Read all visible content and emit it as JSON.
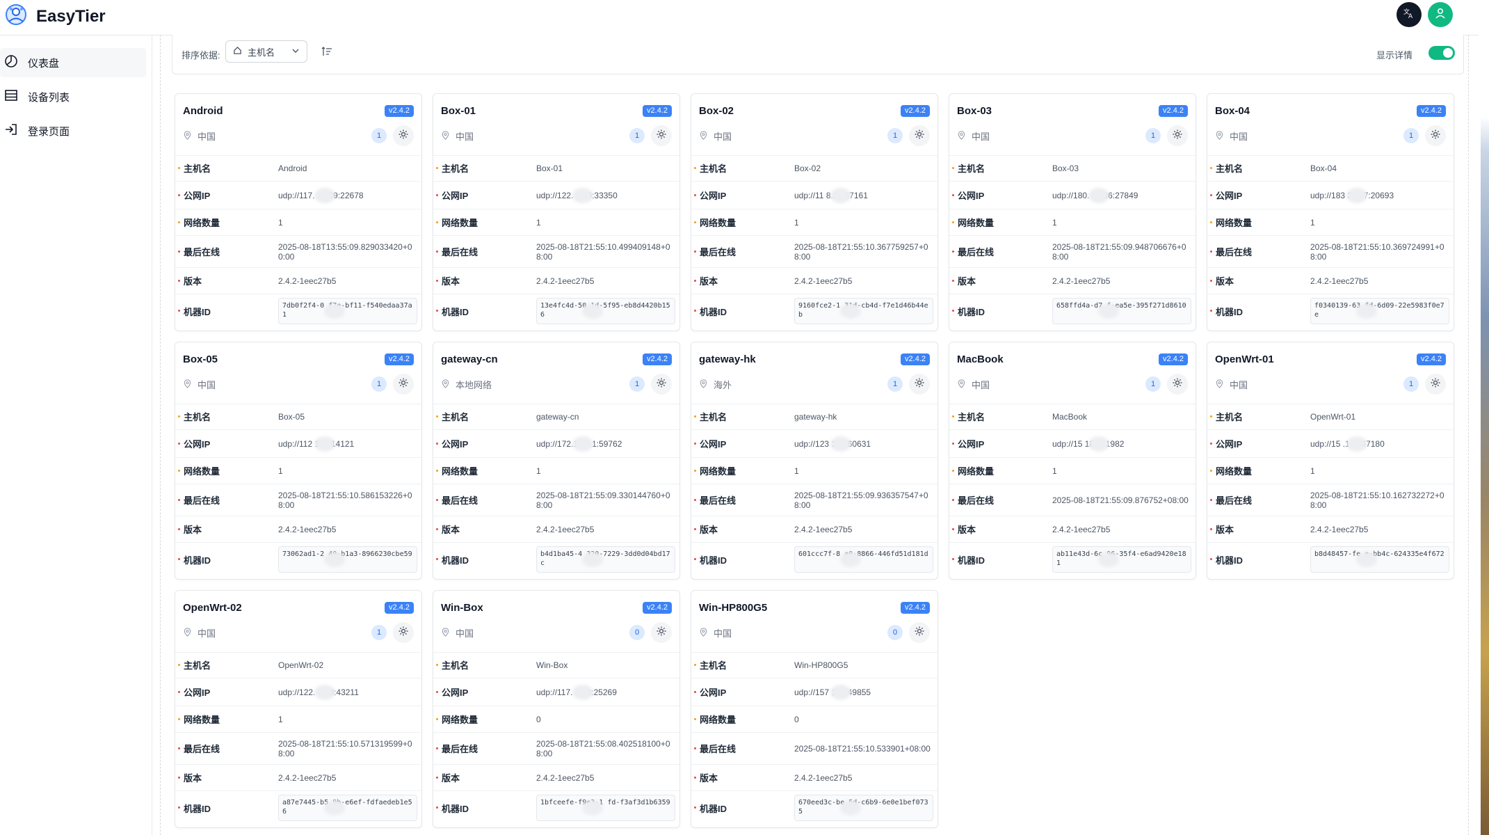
{
  "app": {
    "title": "EasyTier"
  },
  "nav": [
    {
      "label": "仪表盘",
      "icon": "dashboard-icon",
      "active": true
    },
    {
      "label": "设备列表",
      "icon": "list-icon",
      "active": false
    },
    {
      "label": "登录页面",
      "icon": "login-icon",
      "active": false
    }
  ],
  "toolbar": {
    "sort_label": "排序依据:",
    "sort_value": "主机名",
    "toggle_label": "显示详情",
    "toggle_on": true
  },
  "fields": {
    "hostname": "主机名",
    "public_ip": "公网IP",
    "network_count": "网络数量",
    "last_seen": "最后在线",
    "version": "版本",
    "machine_id": "机器ID"
  },
  "colors": {
    "accent": "#10b981",
    "version_badge": "#3b82f6",
    "count_badge": "#dbeafe"
  },
  "devices": [
    {
      "name": "Android",
      "badge": "v2.4.2",
      "location": "中国",
      "count": "1",
      "hostname": "Android",
      "public_ip": "udp://117.  23.39:22678",
      "network_count": "1",
      "last_seen": "2025-08-18T13:55:09.829033420+00:00",
      "version": "2.4.2-1eec27b5",
      "machine_id": "7db0f2f4-0    f7e-bf11-f540edaa37a1"
    },
    {
      "name": "Box-01",
      "badge": "v2.4.2",
      "location": "中国",
      "count": "1",
      "hostname": "Box-01",
      "public_ip": "udp://122.    3.10:33350",
      "network_count": "1",
      "last_seen": "2025-08-18T21:55:10.499409148+08:00",
      "version": "2.4.2-1eec27b5",
      "machine_id": "13e4fc4d-50    1d-5f95-eb8d4420b156"
    },
    {
      "name": "Box-02",
      "badge": "v2.4.2",
      "location": "中国",
      "count": "1",
      "hostname": "Box-02",
      "public_ip": "udp://11    8.27:37161",
      "network_count": "1",
      "last_seen": "2025-08-18T21:55:10.367759257+08:00",
      "version": "2.4.2-1eec27b5",
      "machine_id": "9160fce2-1    31d-cb4d-f7e1d46b44eb"
    },
    {
      "name": "Box-03",
      "badge": "v2.4.2",
      "location": "中国",
      "count": "1",
      "hostname": "Box-03",
      "public_ip": "udp://180.    3.186:27849",
      "network_count": "1",
      "last_seen": "2025-08-18T21:55:09.948706676+08:00",
      "version": "2.4.2-1eec27b5",
      "machine_id": "658ffd4a-d7    f-ea5e-395f271d8610"
    },
    {
      "name": "Box-04",
      "badge": "v2.4.2",
      "location": "中国",
      "count": "1",
      "hostname": "Box-04",
      "public_ip": "udp://183    39.17:20693",
      "network_count": "1",
      "last_seen": "2025-08-18T21:55:10.369724991+08:00",
      "version": "2.4.2-1eec27b5",
      "machine_id": "f0340139-63    fd-6d09-22e5983f0e7e"
    },
    {
      "name": "Box-05",
      "badge": "v2.4.2",
      "location": "中国",
      "count": "1",
      "hostname": "Box-05",
      "public_ip": "udp://112    107:14121",
      "network_count": "1",
      "last_seen": "2025-08-18T21:55:10.586153226+08:00",
      "version": "2.4.2-1eec27b5",
      "machine_id": "73062ad1-2    40-b1a3-8966230cbe59"
    },
    {
      "name": "gateway-cn",
      "badge": "v2.4.2",
      "location": "本地网络",
      "count": "1",
      "hostname": "gateway-cn",
      "public_ip": "udp://172.19.0.1:59762",
      "network_count": "1",
      "last_seen": "2025-08-18T21:55:09.330144760+08:00",
      "version": "2.4.2-1eec27b5",
      "machine_id": "b4d1ba45-4    320-7229-3dd0d04bd17c"
    },
    {
      "name": "gateway-hk",
      "badge": "v2.4.2",
      "location": "海外",
      "count": "1",
      "hostname": "gateway-hk",
      "public_ip": "udp://123    120:60631",
      "network_count": "1",
      "last_seen": "2025-08-18T21:55:09.936357547+08:00",
      "version": "2.4.2-1eec27b5",
      "machine_id": "601ccc7f-8    a0-8866-446fd51d181d"
    },
    {
      "name": "MacBook",
      "badge": "v2.4.2",
      "location": "中国",
      "count": "1",
      "hostname": "MacBook",
      "public_ip": "udp://15    184:51982",
      "network_count": "1",
      "last_seen": "2025-08-18T21:55:09.876752+08:00",
      "version": "2.4.2-1eec27b5",
      "machine_id": "ab11e43d-6c    96-35f4-e6ad9420e181"
    },
    {
      "name": "OpenWrt-01",
      "badge": "v2.4.2",
      "location": "中国",
      "count": "1",
      "hostname": "OpenWrt-01",
      "public_ip": "udp://15    .184:47180",
      "network_count": "1",
      "last_seen": "2025-08-18T21:55:10.162732272+08:00",
      "version": "2.4.2-1eec27b5",
      "machine_id": "b8d48457-fe    e-bb4c-624335e4f672"
    },
    {
      "name": "OpenWrt-02",
      "badge": "v2.4.2",
      "location": "中国",
      "count": "1",
      "hostname": "OpenWrt-02",
      "public_ip": "udp://122.    9.10:43211",
      "network_count": "1",
      "last_seen": "2025-08-18T21:55:10.571319599+08:00",
      "version": "2.4.2-1eec27b5",
      "machine_id": "a87e7445-b5    9b-e6ef-fdfaedeb1e56"
    },
    {
      "name": "Win-Box",
      "badge": "v2.4.2",
      "location": "中国",
      "count": "0",
      "hostname": "Win-Box",
      "public_ip": "udp://117.    3.39:25269",
      "network_count": "0",
      "last_seen": "2025-08-18T21:55:08.402518100+08:00",
      "version": "2.4.2-1eec27b5",
      "machine_id": "1bfceefe-f9e3-1    fd-f3af3d1b6359"
    },
    {
      "name": "Win-HP800G5",
      "badge": "v2.4.2",
      "location": "中国",
      "count": "0",
      "hostname": "Win-HP800G5",
      "public_ip": "udp://157    184:49855",
      "network_count": "0",
      "last_seen": "2025-08-18T21:55:10.533901+08:00",
      "version": "2.4.2-1eec27b5",
      "machine_id": "670eed3c-be    5d-c6b9-6e0e1bef0735"
    }
  ]
}
